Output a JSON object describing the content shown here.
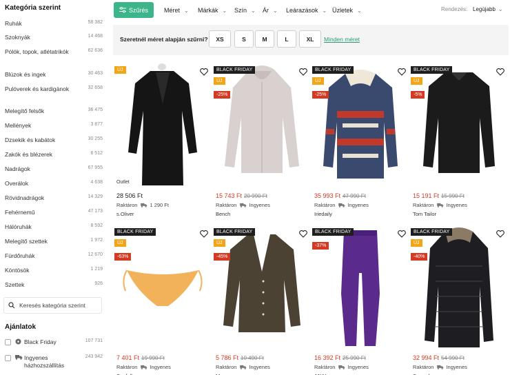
{
  "sidebar": {
    "title": "Kategória szerint",
    "categories": [
      {
        "label": "Ruhák",
        "count": "58 382"
      },
      {
        "label": "Szoknyák",
        "count": "14 468"
      },
      {
        "label": "Pólók, topok, atlétatrikók",
        "count": "62 636"
      },
      {
        "label": "Blúzok és ingek",
        "count": "30 463"
      },
      {
        "label": "Pulóverek és kardigánok",
        "count": "32 658"
      },
      {
        "label": "Melegítő felsők",
        "count": "36 475"
      },
      {
        "label": "Mellények",
        "count": "3 877"
      },
      {
        "label": "Dzsekik és kabátok",
        "count": "30 255"
      },
      {
        "label": "Zakók és blézerek",
        "count": "6 512"
      },
      {
        "label": "Nadrágok",
        "count": "67 955"
      },
      {
        "label": "Overálok",
        "count": "4 638"
      },
      {
        "label": "Rövidnadrágok",
        "count": "14 329"
      },
      {
        "label": "Fehérnemű",
        "count": "47 173"
      },
      {
        "label": "Hálóruhák",
        "count": "8 592"
      },
      {
        "label": "Melegítő szettek",
        "count": "1 972"
      },
      {
        "label": "Fürdőruhák",
        "count": "12 670"
      },
      {
        "label": "Köntösök",
        "count": "1 219"
      },
      {
        "label": "Szettek",
        "count": "926"
      }
    ],
    "search_placeholder": "Keresés kategória szerint",
    "offers_title": "Ajánlatok",
    "offers": [
      {
        "label": "Black Friday",
        "count": "107 731",
        "icon": "tag-icon"
      },
      {
        "label": "Ingyenes házhozszállítás",
        "count": "243 942",
        "icon": "truck-icon"
      }
    ]
  },
  "topbar": {
    "filter_label": "Szűrés",
    "menus": [
      "Méret",
      "Márkák",
      "Szín",
      "Ár",
      "Leárazások",
      "Üzletek"
    ],
    "sort_label": "Rendezés:",
    "sort_value": "Legújabb"
  },
  "sizes": {
    "question": "Szeretnél méret alapján szűrni?",
    "options": [
      "XS",
      "S",
      "M",
      "L",
      "XL"
    ],
    "all_link": "Minden méret"
  },
  "products": [
    {
      "bf": "",
      "new": "ÚJ",
      "discount": "",
      "outlet": "Outlet",
      "price": "28 506 Ft",
      "old_price": "",
      "stock": "Raktáron",
      "shipping": "1 290 Ft",
      "brand": "s.Oliver",
      "color": "#151515",
      "kind": "coat"
    },
    {
      "bf": "BLACK FRIDAY",
      "new": "ÚJ",
      "discount": "-25%",
      "outlet": "",
      "price": "15 743 Ft",
      "old_price": "20 990 Ft",
      "stock": "Raktáron",
      "shipping": "Ingyenes",
      "brand": "Bench",
      "color": "#d9d1cf",
      "kind": "hoodie"
    },
    {
      "bf": "BLACK FRIDAY",
      "new": "ÚJ",
      "discount": "-25%",
      "outlet": "",
      "price": "35 993 Ft",
      "old_price": "47 990 Ft",
      "stock": "Raktáron",
      "shipping": "Ingyenes",
      "brand": "Iriedaily",
      "color": "#3a4a6e",
      "kind": "jacket"
    },
    {
      "bf": "BLACK FRIDAY",
      "new": "ÚJ",
      "discount": "-5%",
      "outlet": "",
      "price": "15 191 Ft",
      "old_price": "15 990 Ft",
      "stock": "Raktáron",
      "shipping": "Ingyenes",
      "brand": "Tom Tailor",
      "color": "#1b1b1b",
      "kind": "sweater"
    },
    {
      "bf": "BLACK FRIDAY",
      "new": "ÚJ",
      "discount": "-63%",
      "outlet": "",
      "price": "7 401 Ft",
      "old_price": "19 990 Ft",
      "stock": "Raktáron",
      "shipping": "Ingyenes",
      "brand": "Seafolly",
      "color": "#f2b25a",
      "kind": "bikini"
    },
    {
      "bf": "BLACK FRIDAY",
      "new": "ÚJ",
      "discount": "-45%",
      "outlet": "",
      "price": "5 786 Ft",
      "old_price": "10 490 Ft",
      "stock": "Raktáron",
      "shipping": "Ingyenes",
      "brand": "Mango",
      "color": "#4b4233",
      "kind": "cardigan"
    },
    {
      "bf": "BLACK FRIDAY",
      "new": "",
      "discount": "-37%",
      "outlet": "",
      "price": "16 392 Ft",
      "old_price": "25 990 Ft",
      "stock": "Raktáron",
      "shipping": "Ingyenes",
      "brand": "JJXX",
      "color": "#5a2a8c",
      "kind": "pants"
    },
    {
      "bf": "BLACK FRIDAY",
      "new": "ÚJ",
      "discount": "-40%",
      "outlet": "",
      "price": "32 994 Ft",
      "old_price": "54 990 Ft",
      "stock": "Raktáron",
      "shipping": "Ingyenes",
      "brand": "Superdry",
      "color": "#1e1e22",
      "kind": "parka"
    }
  ],
  "colors": {
    "accent": "#3cb58a",
    "sale": "#d23a23",
    "new": "#f2a516",
    "bf": "#1e1e1e"
  }
}
